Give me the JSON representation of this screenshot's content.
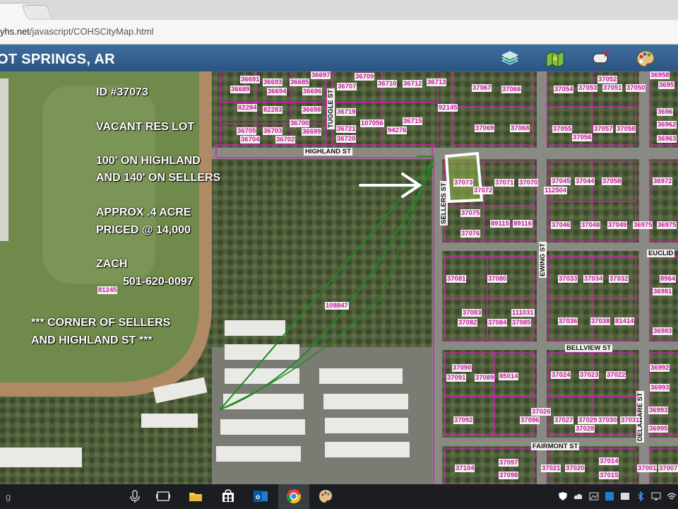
{
  "browser": {
    "url_host": "yhs.net",
    "url_path": "/javascript/COHSCityMap.html"
  },
  "header": {
    "title": "OT SPRINGS, AR",
    "tools": [
      "layers-icon",
      "map-icon",
      "mailbox-icon",
      "palette-icon"
    ]
  },
  "annotation": {
    "id": "ID #37073",
    "type": "VACANT RES LOT",
    "frontage1": "100' ON HIGHLAND",
    "frontage2": "AND 140' ON SELLERS",
    "size": "APPROX .4 ACRE",
    "price": "PRICED @ 14,000",
    "contact": "ZACH",
    "phone": "501-620-0097",
    "corner1": "*** CORNER OF SELLERS",
    "corner2": "AND HIGHLAND ST ***"
  },
  "streets": {
    "highland": "HIGHLAND ST",
    "tuggle": "TUGGLE ST",
    "sellers": "SELLERS ST",
    "ewing": "EWING ST",
    "euclid": "EUCLID",
    "bellview": "BELLVIEW ST",
    "fairmont": "FAIRMONT ST",
    "delaware": "DELAWARE ST"
  },
  "parcels": [
    "36691",
    "36693",
    "36685",
    "36697",
    "36709",
    "36689",
    "36694",
    "36696",
    "36707",
    "36710",
    "36712",
    "36713",
    "82284",
    "82283",
    "36698",
    "36719",
    "36705",
    "36703",
    "36700",
    "36721",
    "107056",
    "94276",
    "36715",
    "36704",
    "36702",
    "36699",
    "36720",
    "92145",
    "37067",
    "37066",
    "37054",
    "37053",
    "37051",
    "37050",
    "37052",
    "36958",
    "3695",
    "37069",
    "37068",
    "37055",
    "37057",
    "37058",
    "37056",
    "3696",
    "36962",
    "36963",
    "37073",
    "37072",
    "37071",
    "37070",
    "37045",
    "37044",
    "37058",
    "112504",
    "36972",
    "37075",
    "89115",
    "89116",
    "37046",
    "37048",
    "37049",
    "36975",
    "36975",
    "37076",
    "37081",
    "37080",
    "37033",
    "37034",
    "37032",
    "8964",
    "36981",
    "108847",
    "81245",
    "37083",
    "111031",
    "37082",
    "37084",
    "37085",
    "37036",
    "37038",
    "81414",
    "36983",
    "37090",
    "37091",
    "37089",
    "85014",
    "37024",
    "37023",
    "37022",
    "36992",
    "36993",
    "37026",
    "37092",
    "37096",
    "37027",
    "37029",
    "37030",
    "37031",
    "37028",
    "36993",
    "36995",
    "37104",
    "37097",
    "37098",
    "37021",
    "37020",
    "37014",
    "37015",
    "37001",
    "37007"
  ],
  "taskbar": {
    "search_icon": "microphone-icon",
    "apps": [
      "task-view-icon",
      "file-explorer-icon",
      "store-icon",
      "outlook-icon",
      "chrome-icon",
      "paint-icon"
    ]
  },
  "colors": {
    "parcel": "#d21fb4",
    "selected_parcel": "#ffffff",
    "right_of_way": "#1e8a1e",
    "header": "#2f5b8a"
  }
}
